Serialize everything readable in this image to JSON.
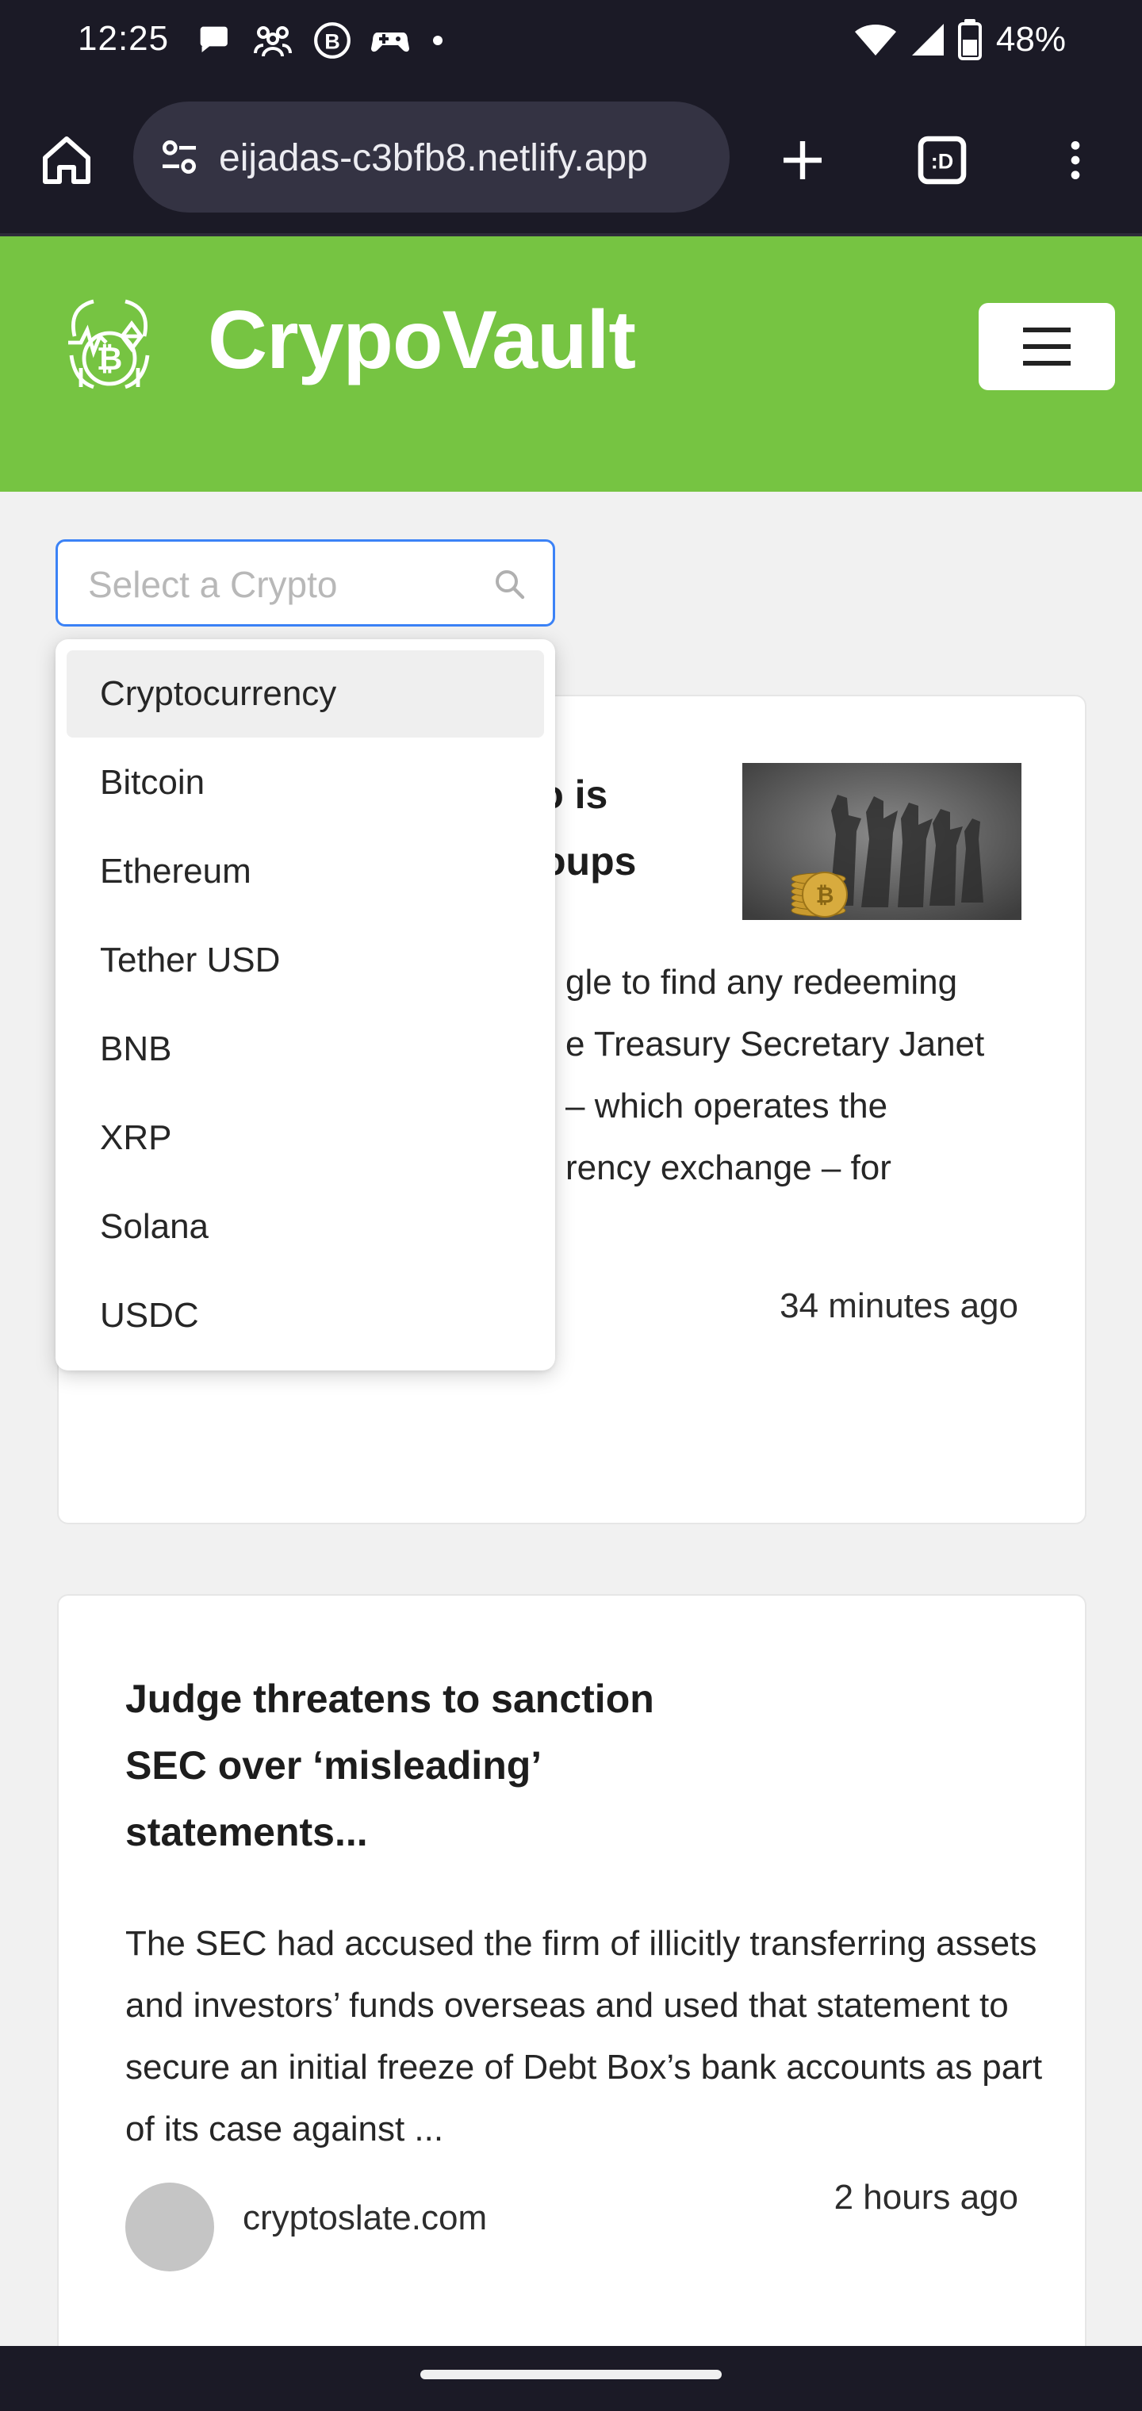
{
  "status_bar": {
    "time": "12:25",
    "battery_percent": "48%",
    "notification_icons": [
      "chat-bubble-icon",
      "people-group-icon",
      "bold-b-icon",
      "game-controller-icon",
      "dot-icon"
    ],
    "system_icons": [
      "wifi-icon",
      "signal-icon",
      "battery-icon"
    ]
  },
  "browser": {
    "url": "eijadas-c3bfb8.netlify.app",
    "tab_count_label": ":D"
  },
  "site": {
    "brand_name": "CrypoVault",
    "accent_color": "#76c442"
  },
  "search": {
    "placeholder": "Select a Crypto",
    "value": ""
  },
  "dropdown": {
    "items": [
      "Cryptocurrency",
      "Bitcoin",
      "Ethereum",
      "Tether USD",
      "BNB",
      "XRP",
      "Solana",
      "USDC"
    ],
    "active_index": 0
  },
  "articles": [
    {
      "title": "Yellen: ... crypto is ... terror groups",
      "title_line1": "pto is",
      "title_line2": "groups",
      "excerpt_lines": [
        "gle to find any redeeming",
        "e Treasury Secretary Janet",
        "– which operates the",
        "rency exchange – for"
      ],
      "time": "34 minutes ago"
    },
    {
      "title": "Judge threatens to sanction SEC over ‘misleading’ statements...",
      "excerpt": "The SEC had accused the firm of illicitly transferring assets and investors’ funds overseas and used that statement to secure an initial freeze of Debt Box’s bank accounts as part of its case against ...",
      "source": "cryptoslate.com",
      "time": "2 hours ago"
    }
  ]
}
